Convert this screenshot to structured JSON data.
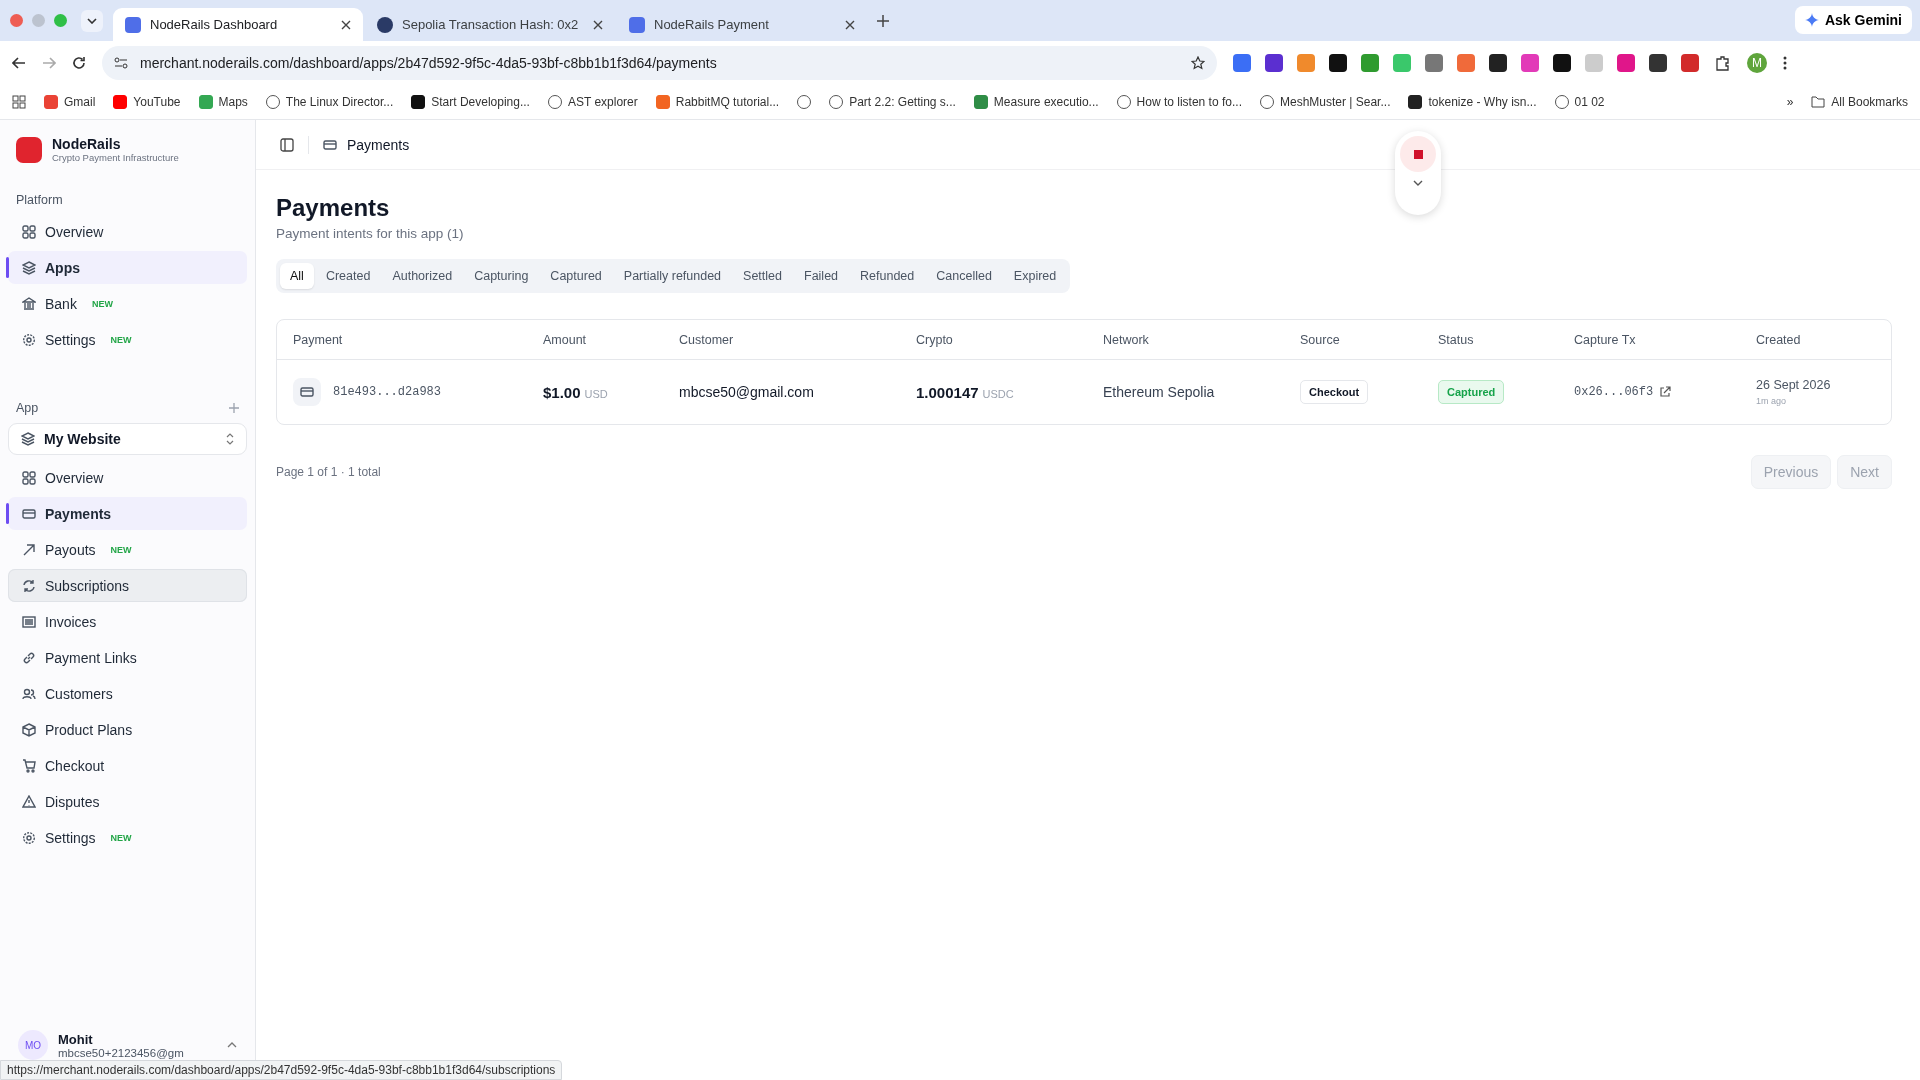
{
  "browser": {
    "tabs": [
      {
        "title": "NodeRails Dashboard",
        "selected": true
      },
      {
        "title": "Sepolia Transaction Hash: 0x2",
        "selected": false
      },
      {
        "title": "NodeRails Payment",
        "selected": false
      }
    ],
    "ask_button": "Ask Gemini",
    "address": "merchant.noderails.com/dashboard/apps/2b47d592-9f5c-4da5-93bf-c8bb1b1f3d64/payments",
    "profile_initial": "M",
    "bookmarks": [
      {
        "label": "Gmail"
      },
      {
        "label": "YouTube"
      },
      {
        "label": "Maps"
      },
      {
        "label": "The Linux Director..."
      },
      {
        "label": "Start Developing..."
      },
      {
        "label": "AST explorer"
      },
      {
        "label": "RabbitMQ tutorial..."
      },
      {
        "kind": "icon_only"
      },
      {
        "label": "Part 2.2: Getting s..."
      },
      {
        "label": "Measure executio..."
      },
      {
        "label": "How to listen to fo..."
      },
      {
        "label": "MeshMuster | Sear..."
      },
      {
        "label": "tokenize - Why isn..."
      },
      {
        "label": "01 02"
      }
    ],
    "more_bookmarks": "»",
    "all_bookmarks": "All Bookmarks"
  },
  "sidebar": {
    "brand": "NodeRails",
    "tagline": "Crypto Payment Infrastructure",
    "platform": {
      "heading": "Platform",
      "items": [
        {
          "label": "Overview",
          "selected": false
        },
        {
          "label": "Apps",
          "selected": true
        },
        {
          "label": "Bank",
          "badge": "NEW",
          "selected": false
        },
        {
          "label": "Settings",
          "badge": "NEW",
          "selected": false
        }
      ]
    },
    "app": {
      "heading": "App",
      "app_select": "My Website",
      "items": [
        {
          "label": "Overview",
          "selected": false,
          "hovered": false
        },
        {
          "label": "Payments",
          "selected": true,
          "hovered": false
        },
        {
          "label": "Payouts",
          "badge": "NEW",
          "selected": false,
          "hovered": false
        },
        {
          "label": "Subscriptions",
          "selected": false,
          "hovered": true
        },
        {
          "label": "Invoices",
          "selected": false,
          "hovered": false
        },
        {
          "label": "Payment Links",
          "selected": false,
          "hovered": false
        },
        {
          "label": "Customers",
          "selected": false,
          "hovered": false
        },
        {
          "label": "Product Plans",
          "selected": false,
          "hovered": false
        },
        {
          "label": "Checkout",
          "selected": false,
          "hovered": false
        },
        {
          "label": "Disputes",
          "selected": false,
          "hovered": false
        },
        {
          "label": "Settings",
          "badge": "NEW",
          "selected": false,
          "hovered": false
        }
      ]
    },
    "user": {
      "initials": "MO",
      "name": "Mohit",
      "email": "mbcse50+2123456@gm"
    }
  },
  "header": {
    "breadcrumb": "Payments"
  },
  "page": {
    "title": "Payments",
    "subtitle": "Payment intents for this app (1)",
    "filters": [
      {
        "label": "All",
        "selected": true
      },
      {
        "label": "Created",
        "selected": false
      },
      {
        "label": "Authorized",
        "selected": false
      },
      {
        "label": "Capturing",
        "selected": false
      },
      {
        "label": "Captured",
        "selected": false
      },
      {
        "label": "Partially refunded",
        "selected": false
      },
      {
        "label": "Settled",
        "selected": false
      },
      {
        "label": "Failed",
        "selected": false
      },
      {
        "label": "Refunded",
        "selected": false
      },
      {
        "label": "Cancelled",
        "selected": false
      },
      {
        "label": "Expired",
        "selected": false
      }
    ],
    "table": {
      "columns": [
        "Payment",
        "Amount",
        "Customer",
        "Crypto",
        "Network",
        "Source",
        "Status",
        "Capture Tx",
        "Created"
      ],
      "rows": [
        {
          "payment": "81e493...d2a983",
          "amount": "$1.00",
          "amount_currency": "USD",
          "customer": "mbcse50@gmail.com",
          "crypto": "1.000147",
          "crypto_token": "USDC",
          "network": "Ethereum Sepolia",
          "source": "Checkout",
          "status": "Captured",
          "capture_tx": "0x26...06f3",
          "created": "26 Sept 2026",
          "created_ago": "1m ago"
        }
      ]
    },
    "pagination": {
      "summary": "Page 1 of 1 · 1 total",
      "previous": "Previous",
      "next": "Next",
      "previous_disabled": true,
      "next_disabled": true
    }
  },
  "status_url": "https://merchant.noderails.com/dashboard/apps/2b47d592-9f5c-4da5-93bf-c8bb1b1f3d64/subscriptions"
}
